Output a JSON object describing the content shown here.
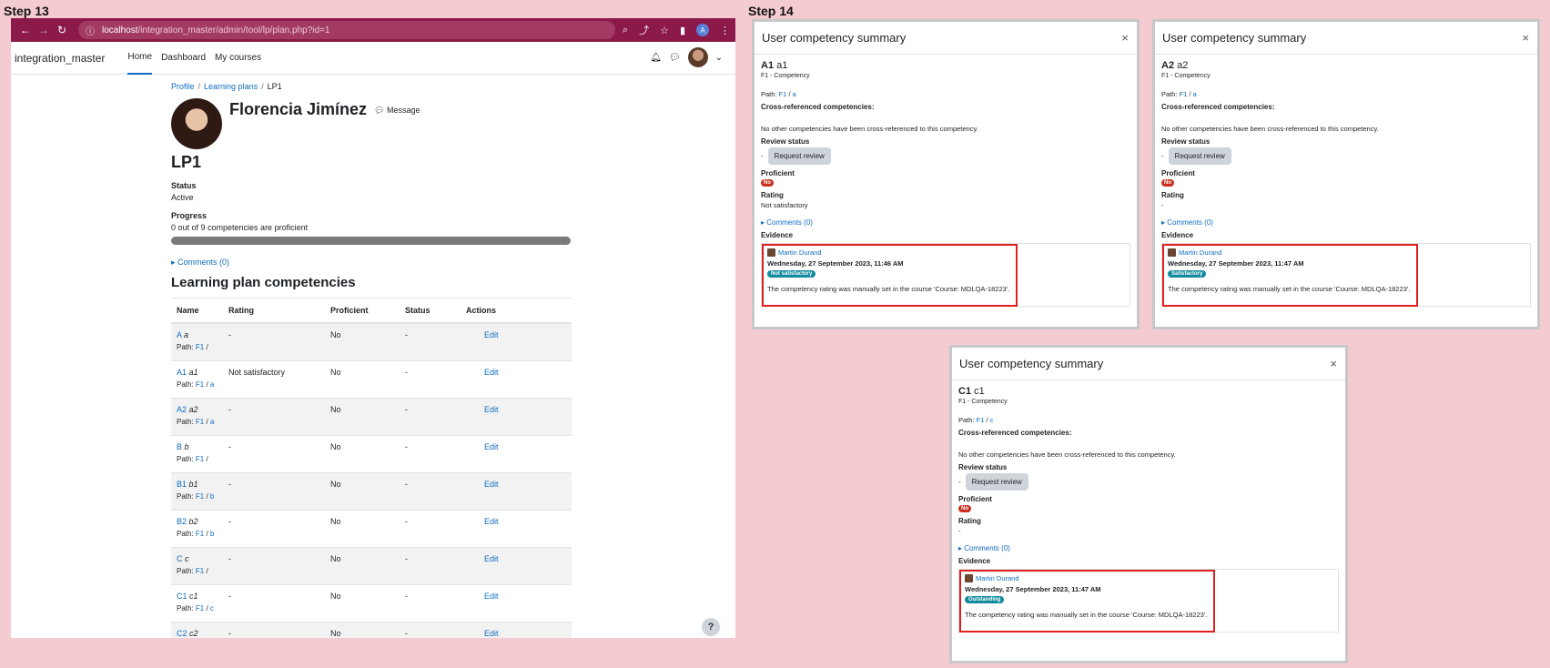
{
  "steps": {
    "left": "Step 13",
    "right": "Step 14"
  },
  "browser": {
    "url_host": "localhost",
    "url_path": "/integration_master/admin/tool/lp/plan.php?id=1",
    "profile_initial": "A"
  },
  "moodle_nav": {
    "site_name": "integration_master",
    "items": [
      "Home",
      "Dashboard",
      "My courses"
    ]
  },
  "page": {
    "breadcrumb": [
      "Profile",
      "Learning plans",
      "LP1"
    ],
    "user_name": "Florencia Jimínez",
    "message_label": "Message",
    "plan_title": "LP1",
    "status_label": "Status",
    "status_value": "Active",
    "progress_label": "Progress",
    "progress_text": "0 out of 9 competencies are proficient",
    "progress_fraction": 0,
    "comments_label": "Comments (0)",
    "section_title": "Learning plan competencies"
  },
  "table": {
    "headers": [
      "Name",
      "Rating",
      "Proficient",
      "Status",
      "Actions"
    ],
    "rows": [
      {
        "code": "A",
        "name": "a",
        "path_fw": "F1",
        "path_parent": "",
        "rating": "-",
        "proficient": "No",
        "status": "-",
        "action": "Edit"
      },
      {
        "code": "A1",
        "name": "a1",
        "path_fw": "F1",
        "path_parent": "a",
        "rating": "Not satisfactory",
        "proficient": "No",
        "status": "-",
        "action": "Edit"
      },
      {
        "code": "A2",
        "name": "a2",
        "path_fw": "F1",
        "path_parent": "a",
        "rating": "-",
        "proficient": "No",
        "status": "-",
        "action": "Edit"
      },
      {
        "code": "B",
        "name": "b",
        "path_fw": "F1",
        "path_parent": "",
        "rating": "-",
        "proficient": "No",
        "status": "-",
        "action": "Edit"
      },
      {
        "code": "B1",
        "name": "b1",
        "path_fw": "F1",
        "path_parent": "b",
        "rating": "-",
        "proficient": "No",
        "status": "-",
        "action": "Edit"
      },
      {
        "code": "B2",
        "name": "b2",
        "path_fw": "F1",
        "path_parent": "b",
        "rating": "-",
        "proficient": "No",
        "status": "-",
        "action": "Edit"
      },
      {
        "code": "C",
        "name": "c",
        "path_fw": "F1",
        "path_parent": "",
        "rating": "-",
        "proficient": "No",
        "status": "-",
        "action": "Edit"
      },
      {
        "code": "C1",
        "name": "c1",
        "path_fw": "F1",
        "path_parent": "c",
        "rating": "-",
        "proficient": "No",
        "status": "-",
        "action": "Edit"
      },
      {
        "code": "C2",
        "name": "c2",
        "path_fw": "F1",
        "path_parent": "c",
        "rating": "-",
        "proficient": "No",
        "status": "-",
        "action": "Edit"
      }
    ]
  },
  "help_label": "?",
  "modal_common": {
    "title": "User competency summary",
    "close": "×",
    "framework_line": "F1 - Competency",
    "path_prefix": "Path: ",
    "cross_label": "Cross-referenced competencies:",
    "cross_text": "No other competencies have been cross-referenced to this competency.",
    "review_label": "Review status",
    "review_dash": "-",
    "request_review": "Request review",
    "proficient_label": "Proficient",
    "proficient_badge": "No",
    "rating_label": "Rating",
    "comments_label": "Comments (0)",
    "evidence_label": "Evidence",
    "evidence_user": "Martin Durand",
    "evidence_note": "The competency rating was manually set in the course 'Course: MDLQA-18223'."
  },
  "modals": [
    {
      "code": "A1",
      "name": "a1",
      "path_fw": "F1",
      "path_parent": "a",
      "rating": "Not satisfactory",
      "ev_date": "Wednesday, 27 September 2023, 11:46 AM",
      "ev_badge": "Not satisfactory"
    },
    {
      "code": "A2",
      "name": "a2",
      "path_fw": "F1",
      "path_parent": "a",
      "rating": "-",
      "ev_date": "Wednesday, 27 September 2023, 11:47 AM",
      "ev_badge": "Satisfactory"
    },
    {
      "code": "C1",
      "name": "c1",
      "path_fw": "F1",
      "path_parent": "c",
      "rating": "-",
      "ev_date": "Wednesday, 27 September 2023, 11:47 AM",
      "ev_badge": "Outstanding"
    }
  ],
  "colors": {
    "chrome": "#8b1a4a",
    "link": "#0f6cbf",
    "badge_red": "#ca3120",
    "badge_teal": "#138a9e",
    "highlight": "#e0201d"
  }
}
